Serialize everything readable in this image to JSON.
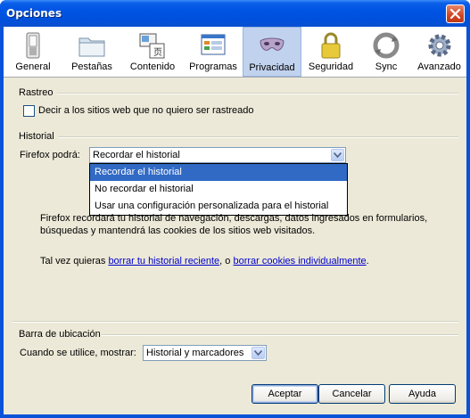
{
  "window": {
    "title": "Opciones"
  },
  "tabs": [
    {
      "label": "General",
      "icon": "switch-icon"
    },
    {
      "label": "Pestañas",
      "icon": "folder-tabs-icon"
    },
    {
      "label": "Contenido",
      "icon": "content-icon"
    },
    {
      "label": "Programas",
      "icon": "applications-icon"
    },
    {
      "label": "Privacidad",
      "icon": "mask-icon",
      "active": true
    },
    {
      "label": "Seguridad",
      "icon": "padlock-icon"
    },
    {
      "label": "Sync",
      "icon": "sync-icon"
    },
    {
      "label": "Avanzado",
      "icon": "gear-icon"
    }
  ],
  "rastreo": {
    "label": "Rastreo",
    "checkbox_label": "Decir a los sitios web que no quiero ser rastreado",
    "checked": false
  },
  "historial": {
    "label": "Historial",
    "firefox_label": "Firefox podrá:",
    "selected": "Recordar el historial",
    "options": [
      "Recordar el historial",
      "No recordar el historial",
      "Usar una configuración personalizada para el historial"
    ],
    "desc_line1": "Firefox recordará tu historial de navegación, descargas, datos ingresados en formularios,",
    "desc_line2": "búsquedas y mantendrá las cookies de los sitios web visitados.",
    "hint_prefix": "Tal vez quieras ",
    "link1": "borrar tu historial reciente",
    "hint_middle": ", o ",
    "link2": "borrar cookies individualmente",
    "hint_suffix": "."
  },
  "barra": {
    "label": "Barra de ubicación",
    "field_label": "Cuando se utilice, mostrar:",
    "selected": "Historial y marcadores"
  },
  "buttons": {
    "ok": "Aceptar",
    "cancel": "Cancelar",
    "help": "Ayuda"
  },
  "colors": {
    "titlebar": "#0054e3",
    "selection": "#316ac5",
    "active_tab": "#c1d2ee",
    "link": "#0000cc"
  }
}
